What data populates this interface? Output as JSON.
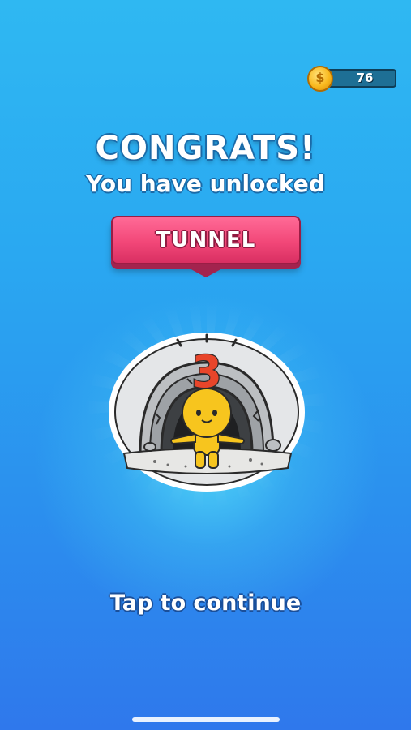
{
  "currency": {
    "coins": "76",
    "symbol": "$"
  },
  "unlock": {
    "title": "CONGRATS!",
    "subtitle": "You have unlocked",
    "item_name": "TUNNEL",
    "level_number": "3"
  },
  "continue_label": "Tap to continue",
  "colors": {
    "background_top": "#2fb8f2",
    "background_bottom": "#2f78ec",
    "badge": "#f24778",
    "coin": "#f9b91f",
    "character": "#f7c51e",
    "number": "#e8452a"
  }
}
